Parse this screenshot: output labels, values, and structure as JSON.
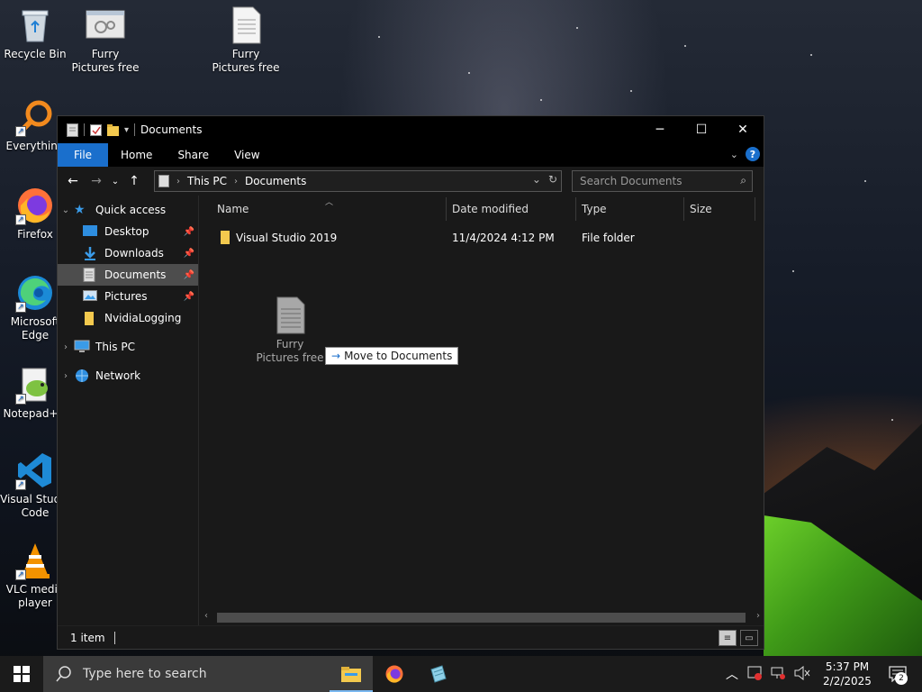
{
  "desktop": {
    "icons": [
      {
        "label": "Recycle Bin",
        "icon": "recycle-bin-icon"
      },
      {
        "label": "Furry Pictures free",
        "icon": "gear-file-icon"
      },
      {
        "label": "Furry Pictures free",
        "icon": "text-file-icon"
      },
      {
        "label": "Everything",
        "icon": "magnifier-icon"
      },
      {
        "label": "Firefox",
        "icon": "firefox-icon"
      },
      {
        "label": "Microsoft Edge",
        "icon": "edge-icon"
      },
      {
        "label": "Notepad++",
        "icon": "notepadpp-icon"
      },
      {
        "label": "Visual Studio Code",
        "icon": "vscode-icon"
      },
      {
        "label": "VLC media player",
        "icon": "vlc-icon"
      }
    ]
  },
  "explorer": {
    "title": "Documents",
    "ribbon": {
      "tabs": [
        "File",
        "Home",
        "Share",
        "View"
      ]
    },
    "address": {
      "crumbs": [
        "This PC",
        "Documents"
      ]
    },
    "search": {
      "placeholder": "Search Documents"
    },
    "nav": {
      "quick_access": "Quick access",
      "items": [
        "Desktop",
        "Downloads",
        "Documents",
        "Pictures",
        "NvidiaLogging"
      ],
      "this_pc": "This PC",
      "network": "Network"
    },
    "columns": {
      "name": "Name",
      "date": "Date modified",
      "type": "Type",
      "size": "Size"
    },
    "files": [
      {
        "name": "Visual Studio 2019",
        "date": "11/4/2024 4:12 PM",
        "type": "File folder",
        "size": ""
      }
    ],
    "drag": {
      "ghost_label": "Furry Pictures free",
      "tooltip": "Move to Documents"
    },
    "status": {
      "count": "1 item"
    }
  },
  "taskbar": {
    "search_placeholder": "Type here to search",
    "time": "5:37 PM",
    "date": "2/2/2025",
    "notifications": "2"
  },
  "colors": {
    "accent": "#1a6fcc",
    "window_bg": "#191919",
    "selected": "#4d4d4d"
  }
}
